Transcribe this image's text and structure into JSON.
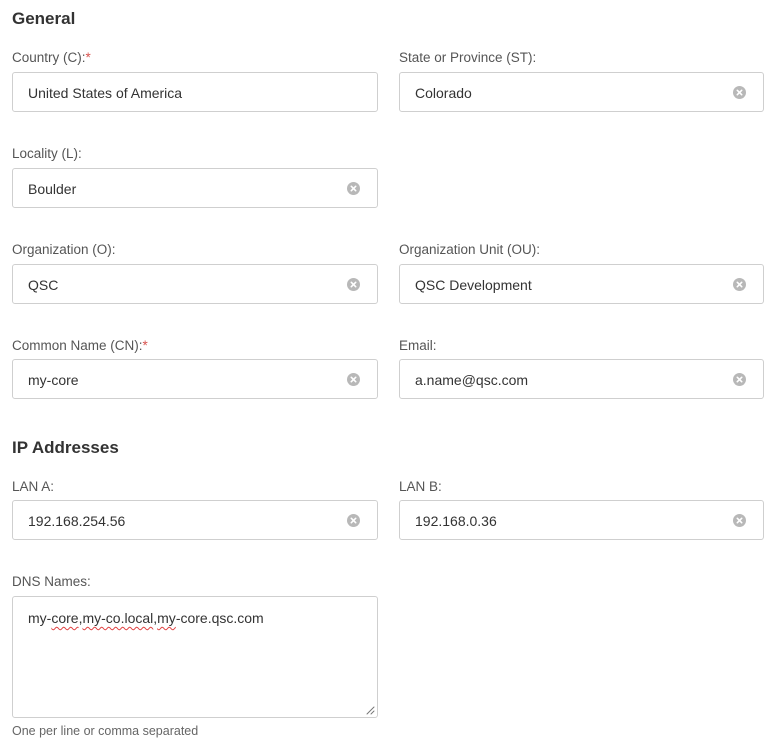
{
  "general": {
    "title": "General",
    "fields": {
      "country": {
        "label": "Country (C):",
        "required_mark": "*",
        "value": "United States of America"
      },
      "state": {
        "label": "State or Province (ST):",
        "value": "Colorado"
      },
      "locality": {
        "label": "Locality (L):",
        "value": "Boulder"
      },
      "organization": {
        "label": "Organization (O):",
        "value": "QSC"
      },
      "org_unit": {
        "label": "Organization Unit (OU):",
        "value": "QSC Development"
      },
      "common_name": {
        "label": "Common Name (CN):",
        "required_mark": "*",
        "value": "my-core"
      },
      "email": {
        "label": "Email:",
        "value": "a.name@qsc.com"
      }
    }
  },
  "ip_addresses": {
    "title": "IP Addresses",
    "fields": {
      "lan_a": {
        "label": "LAN A:",
        "value": "192.168.254.56"
      },
      "lan_b": {
        "label": "LAN B:",
        "value": "192.168.0.36"
      }
    }
  },
  "dns": {
    "label": "DNS Names:",
    "value_parts": [
      "my-",
      "core",
      ",",
      "my-co.local",
      ",",
      "my",
      "-core.qsc.com"
    ],
    "helper": "One per line or comma separated"
  },
  "icons": {
    "clear": "clear-circle-x-icon",
    "resize": "resize-handle-icon"
  },
  "colors": {
    "required": "#d9534f",
    "border": "#cfcfcf",
    "clear_icon": "#b8b8b8",
    "spellcheck": "#e04040"
  }
}
